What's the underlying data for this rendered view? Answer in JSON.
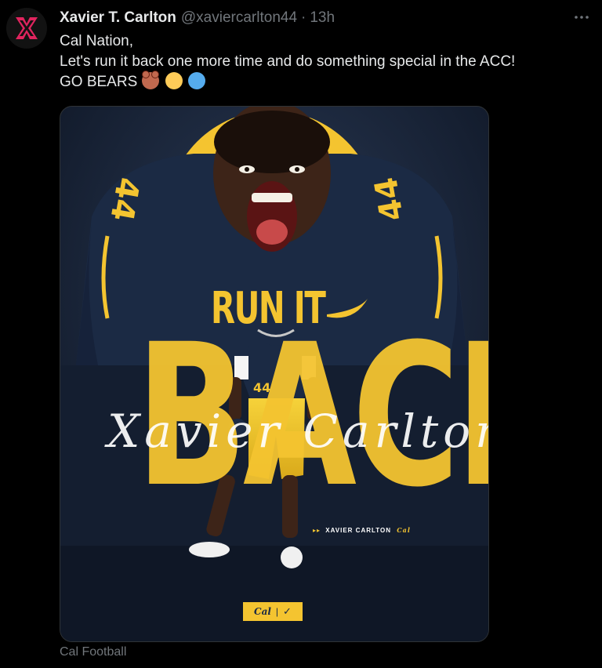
{
  "tweet": {
    "display_name": "Xavier T. Carlton",
    "handle": "@xaviercarlton44",
    "separator": "·",
    "time": "13h",
    "lines": [
      "Cal Nation,",
      "Let's run it back one more time and do something special in the ACC!",
      "GO BEARS"
    ],
    "emojis": [
      "bear-face",
      "yellow-circle",
      "blue-circle"
    ],
    "more_icon": "more-horizontal-icon"
  },
  "media": {
    "headline_top": "RUN IT",
    "headline_main": "BACK",
    "signature": "Xavier Carlton",
    "jersey_number": "44",
    "caption_arrows": "▸▸",
    "caption_name": "XAVIER CARLTON",
    "caption_logo": "Cal",
    "badge_cal": "Cal",
    "badge_separator": "|",
    "badge_nike": "✓",
    "colors": {
      "navy": "#1b2a44",
      "gold": "#f4c430"
    }
  },
  "source_label": "Cal Football",
  "colors": {
    "background": "#000000",
    "text_primary": "#e7e9ea",
    "text_secondary": "#71767b",
    "avatar_accent": "#e0245e"
  }
}
